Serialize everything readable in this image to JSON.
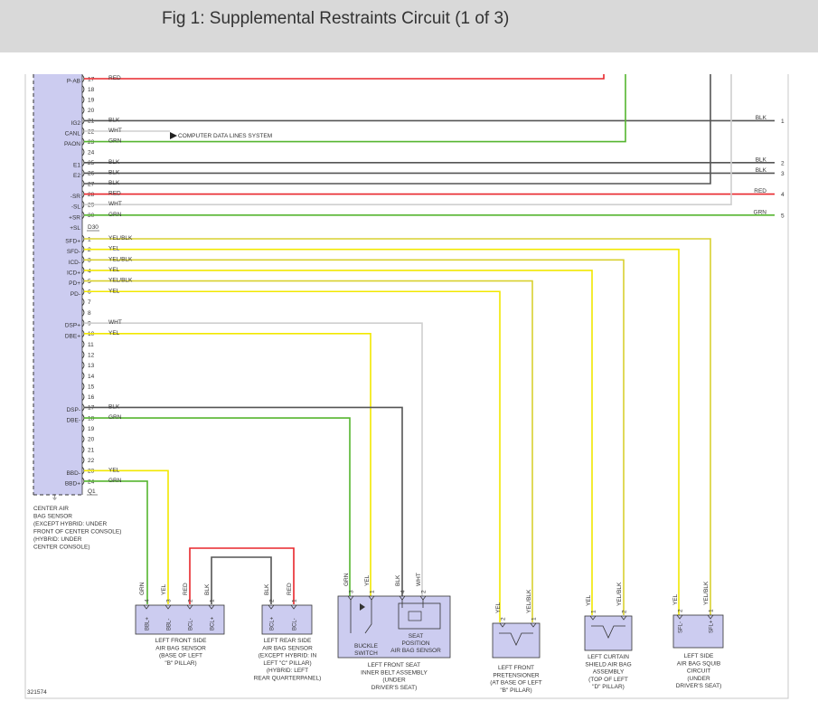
{
  "header": {
    "title": "Fig 1: Supplemental Restraints Circuit (1 of 3)"
  },
  "colors": {
    "RED": "#e8262b",
    "GRN": "#55b52f",
    "BLK": "#555555",
    "WHT": "#cfcfcf",
    "YEL": "#f2e800",
    "YEL/BLK": "#d8d030",
    "module_fill": "#ccccf0",
    "header_bg": "#d9d9d9"
  },
  "module": {
    "name_lines": [
      "CENTER AIR",
      "BAG SENSOR",
      "(EXCEPT HYBRID: UNDER",
      "FRONT OF CENTER CONSOLE)",
      "(HYBRID: UNDER",
      "CENTER CONSOLE)"
    ],
    "connector_top": "D30",
    "connector_bottom": "Q1"
  },
  "pins_top": [
    {
      "num": "17",
      "label": "P-AB",
      "wire": "RED"
    },
    {
      "num": "18",
      "label": "",
      "wire": ""
    },
    {
      "num": "19",
      "label": "",
      "wire": ""
    },
    {
      "num": "20",
      "label": "",
      "wire": ""
    },
    {
      "num": "21",
      "label": "IG2",
      "wire": "BLK"
    },
    {
      "num": "22",
      "label": "CANL",
      "wire": "WHT"
    },
    {
      "num": "23",
      "label": "PAON",
      "wire": "GRN"
    },
    {
      "num": "24",
      "label": "",
      "wire": ""
    },
    {
      "num": "25",
      "label": "E1",
      "wire": "BLK"
    },
    {
      "num": "26",
      "label": "E2",
      "wire": "BLK"
    },
    {
      "num": "27",
      "label": "",
      "wire": "BLK"
    },
    {
      "num": "28",
      "label": "-SR",
      "wire": "RED"
    },
    {
      "num": "29",
      "label": "-SL",
      "wire": "WHT"
    },
    {
      "num": "30",
      "label": "+SR",
      "wire": "GRN"
    },
    {
      "num": "",
      "label": "+SL",
      "wire": ""
    }
  ],
  "pins_bottom": [
    {
      "num": "1",
      "label": "SFD+",
      "wire": "YEL/BLK"
    },
    {
      "num": "2",
      "label": "SFD-",
      "wire": "YEL"
    },
    {
      "num": "3",
      "label": "ICD-",
      "wire": "YEL/BLK"
    },
    {
      "num": "4",
      "label": "ICD+",
      "wire": "YEL"
    },
    {
      "num": "5",
      "label": "PD+",
      "wire": "YEL/BLK"
    },
    {
      "num": "6",
      "label": "PD-",
      "wire": "YEL"
    },
    {
      "num": "7",
      "label": "",
      "wire": ""
    },
    {
      "num": "8",
      "label": "",
      "wire": ""
    },
    {
      "num": "9",
      "label": "DSP+",
      "wire": "WHT"
    },
    {
      "num": "10",
      "label": "DBE+",
      "wire": "YEL"
    },
    {
      "num": "11",
      "label": "",
      "wire": ""
    },
    {
      "num": "12",
      "label": "",
      "wire": ""
    },
    {
      "num": "13",
      "label": "",
      "wire": ""
    },
    {
      "num": "14",
      "label": "",
      "wire": ""
    },
    {
      "num": "15",
      "label": "",
      "wire": ""
    },
    {
      "num": "16",
      "label": "",
      "wire": ""
    },
    {
      "num": "17",
      "label": "DSP-",
      "wire": "BLK"
    },
    {
      "num": "18",
      "label": "DBE-",
      "wire": "GRN"
    },
    {
      "num": "19",
      "label": "",
      "wire": ""
    },
    {
      "num": "20",
      "label": "",
      "wire": ""
    },
    {
      "num": "21",
      "label": "",
      "wire": ""
    },
    {
      "num": "22",
      "label": "",
      "wire": ""
    },
    {
      "num": "23",
      "label": "BBD-",
      "wire": "YEL"
    },
    {
      "num": "24",
      "label": "BBD+",
      "wire": "GRN"
    }
  ],
  "computer_note": "COMPUTER DATA LINES SYSTEM",
  "right_labels": [
    {
      "wire": "BLK",
      "ref": "1"
    },
    {
      "wire": "BLK",
      "ref": "2"
    },
    {
      "wire": "BLK",
      "ref": "3"
    },
    {
      "wire": "RED",
      "ref": "4"
    },
    {
      "wire": "GRN",
      "ref": "5"
    }
  ],
  "components": [
    {
      "id": "lfs",
      "wires": [
        {
          "num": "4",
          "color": "GRN"
        },
        {
          "num": "3",
          "color": "YEL"
        },
        {
          "num": "2",
          "color": "RED"
        },
        {
          "num": "1",
          "color": "BLK"
        }
      ],
      "pins": [
        "BBL+",
        "BBL-",
        "BCL-",
        "BCL+"
      ],
      "caption": [
        "LEFT FRONT SIDE",
        "AIR BAG SENSOR",
        "(BASE OF LEFT",
        "\"B\" PILLAR)"
      ]
    },
    {
      "id": "lrs",
      "wires": [
        {
          "num": "2",
          "color": "BLK"
        },
        {
          "num": "1",
          "color": "RED"
        }
      ],
      "pins": [
        "BCL+",
        "BCL-"
      ],
      "caption": [
        "LEFT REAR SIDE",
        "AIR BAG SENSOR",
        "(EXCEPT HYBRID: IN",
        "LEFT \"C\" PILLAR)",
        "(HYBRID: LEFT",
        "REAR QUARTERPANEL)"
      ]
    },
    {
      "id": "seat",
      "wires": [
        {
          "num": "3",
          "color": "GRN"
        },
        {
          "num": "1",
          "color": "YEL"
        },
        {
          "num": "4",
          "color": "BLK"
        },
        {
          "num": "2",
          "color": "WHT"
        }
      ],
      "buckle": [
        "BUCKLE",
        "SWITCH"
      ],
      "position": [
        "SEAT",
        "POSITION",
        "AIR BAG SENSOR"
      ],
      "caption": [
        "LEFT FRONT SEAT",
        "INNER BELT ASSEMBLY",
        "(UNDER",
        "DRIVER'S SEAT)"
      ]
    },
    {
      "id": "pret",
      "wires": [
        {
          "num": "2",
          "color": "YEL"
        },
        {
          "num": "1",
          "color": "YEL/BLK"
        }
      ],
      "caption": [
        "LEFT FRONT",
        "PRETENSIONER",
        "(AT BASE OF LEFT",
        "\"B\" PILLAR)"
      ]
    },
    {
      "id": "curtain",
      "wires": [
        {
          "num": "1",
          "color": "YEL"
        },
        {
          "num": "2",
          "color": "YEL/BLK"
        }
      ],
      "caption": [
        "LEFT CURTAIN",
        "SHIELD AIR BAG",
        "ASSEMBLY",
        "(TOP OF LEFT",
        "\"D\" PILLAR)"
      ]
    },
    {
      "id": "side",
      "wires": [
        {
          "num": "2",
          "color": "YEL"
        },
        {
          "num": "1",
          "color": "YEL/BLK"
        }
      ],
      "pins": [
        "SFL-",
        "SFL+"
      ],
      "caption": [
        "LEFT SIDE",
        "AIR BAG SQUIB",
        "CIRCUIT",
        "(UNDER",
        "DRIVER'S SEAT)"
      ]
    }
  ],
  "figure_id": "321574"
}
